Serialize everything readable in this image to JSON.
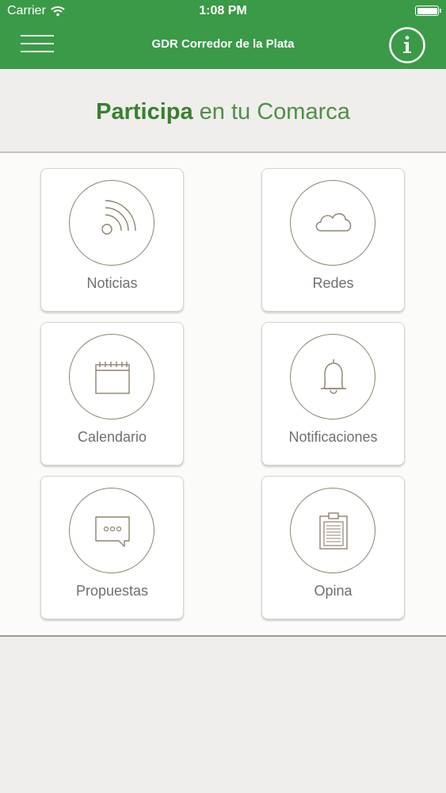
{
  "status_bar": {
    "carrier": "Carrier",
    "time": "1:08 PM"
  },
  "navbar": {
    "title": "GDR Corredor de la Plata",
    "menu_icon": "hamburger-menu-icon",
    "info_icon": "info-icon"
  },
  "hero": {
    "title_bold": "Participa",
    "title_rest": " en tu Comarca"
  },
  "tiles": [
    {
      "label": "Noticias",
      "icon": "rss-icon"
    },
    {
      "label": "Redes",
      "icon": "cloud-icon"
    },
    {
      "label": "Calendario",
      "icon": "calendar-icon"
    },
    {
      "label": "Notificaciones",
      "icon": "bell-icon"
    },
    {
      "label": "Propuestas",
      "icon": "speech-bubble-icon"
    },
    {
      "label": "Opina",
      "icon": "clipboard-icon"
    }
  ],
  "colors": {
    "header": "#3a9a48",
    "title_green": "#3a7f31",
    "icon_stroke": "#8f836e",
    "label_gray": "#6f6f6f"
  }
}
